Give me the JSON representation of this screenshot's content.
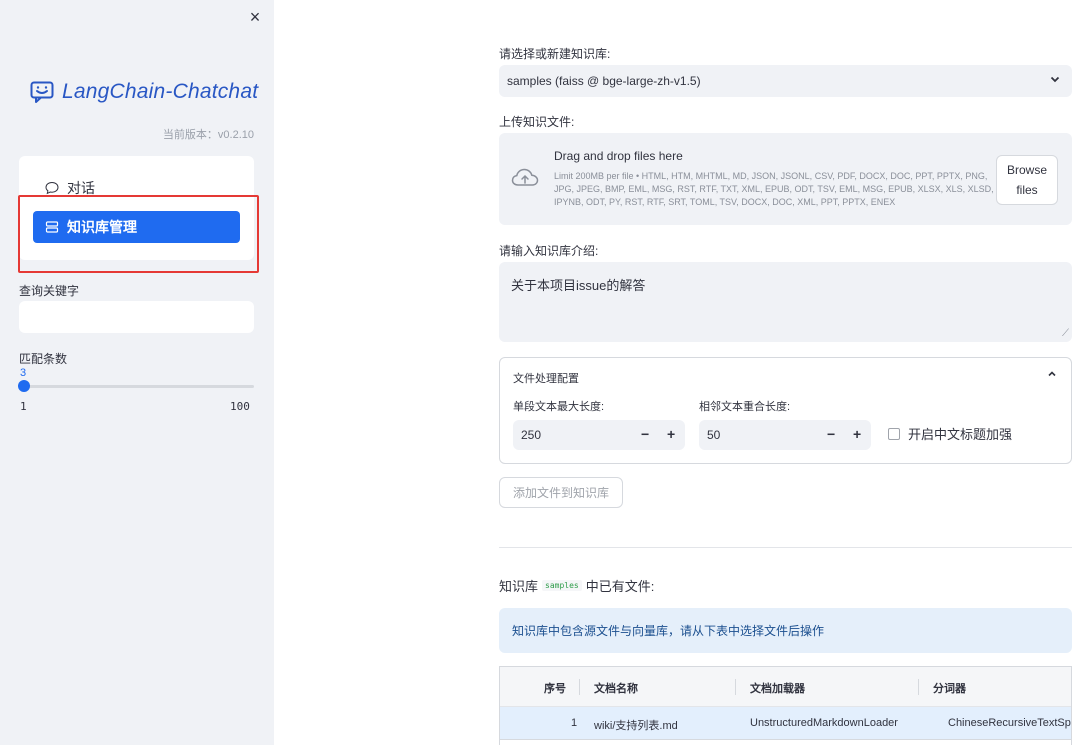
{
  "sidebar": {
    "close_icon": "×",
    "logo_text": "LangChain-Chatchat",
    "version": "当前版本：v0.2.10",
    "nav": [
      {
        "label": "对话",
        "icon": "chat-bubble-icon"
      },
      {
        "label": "知识库管理",
        "icon": "database-icon"
      }
    ],
    "search_label": "查询关键字",
    "search_value": "",
    "match_label": "匹配条数",
    "slider": {
      "value": "3",
      "min": "1",
      "max": "100"
    }
  },
  "main": {
    "select_kb_label": "请选择或新建知识库:",
    "select_kb_value": "samples (faiss @ bge-large-zh-v1.5)",
    "upload_label": "上传知识文件:",
    "uploader": {
      "title": "Drag and drop files here",
      "limit": "Limit 200MB per file • HTML, HTM, MHTML, MD, JSON, JSONL, CSV, PDF, DOCX, DOC, PPT, PPTX, PNG, JPG, JPEG, BMP, EML, MSG, RST, RTF, TXT, XML, EPUB, ODT, TSV, EML, MSG, EPUB, XLSX, XLS, XLSD, IPYNB, ODT, PY, RST, RTF, SRT, TOML, TSV, DOCX, DOC, XML, PPT, PPTX, ENEX",
      "browse_line1": "Browse",
      "browse_line2": "files"
    },
    "intro_label": "请输入知识库介绍:",
    "intro_value": "关于本项目issue的解答",
    "config": {
      "title": "文件处理配置",
      "chunk_size_label": "单段文本最大长度:",
      "chunk_size_value": "250",
      "overlap_label": "相邻文本重合长度:",
      "overlap_value": "50",
      "zh_title_label": "开启中文标题加强"
    },
    "add_button": "添加文件到知识库",
    "kb_heading_prefix": "知识库",
    "kb_heading_code": "samples",
    "kb_heading_suffix": "中已有文件:",
    "info": "知识库中包含源文件与向量库，请从下表中选择文件后操作",
    "table": {
      "headers": [
        "序号",
        "文档名称",
        "文档加载器",
        "分词器"
      ],
      "rows": [
        [
          "1",
          "wiki/支持列表.md",
          "UnstructuredMarkdownLoader",
          "ChineseRecursiveTextSpl"
        ]
      ]
    }
  },
  "colors": {
    "accent": "#1f6bf0",
    "sidebar_bg": "#f0f2f6",
    "highlight": "#e53935",
    "info_bg": "#e5effa"
  }
}
